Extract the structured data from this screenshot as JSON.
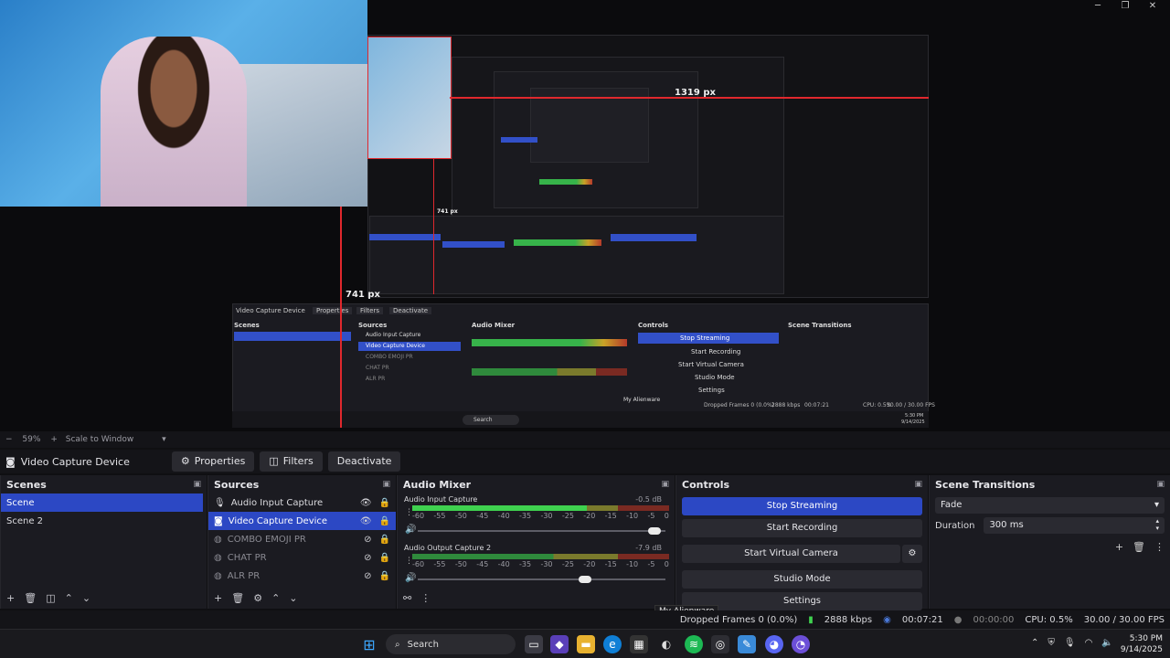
{
  "window": {
    "minimize": "─",
    "restore": "❐",
    "close": "✕"
  },
  "preview": {
    "label_width": "1319 px",
    "label_height_inner": "741 px",
    "label_height": "741 px",
    "nested_scene_title": "Video Capture Device",
    "nested_search": "Search",
    "nested_tooltip": "My Alienware",
    "nested_dropped": "Dropped Frames 0 (0.0%)",
    "nested_kbps": "2888 kbps",
    "nested_time": "00:07:21",
    "nested_cpu": "CPU: 0.5%",
    "nested_fps": "30.00 / 30.00 FPS",
    "nested_clock": "5:30 PM",
    "nested_date": "9/14/2025",
    "nested_items": [
      "Audio Input Capture",
      "Video Capture Device",
      "COMBO EMOJI PR",
      "CHAT PR",
      "ALR PR"
    ],
    "nested_buttons": [
      "Stop Streaming",
      "Start Recording",
      "Start Virtual Camera",
      "Studio Mode",
      "Settings"
    ],
    "nested_docks": [
      "Scenes",
      "Sources",
      "Audio Mixer",
      "Controls",
      "Scene Transitions"
    ],
    "nested_tabs": [
      "Properties",
      "Filters",
      "Deactivate"
    ]
  },
  "status1": {
    "zoom": "59%",
    "mode": "Scale to Window"
  },
  "context": {
    "title": "Video Capture Device",
    "properties": "Properties",
    "filters": "Filters",
    "deactivate": "Deactivate"
  },
  "scenes": {
    "title": "Scenes",
    "items": [
      "Scene",
      "Scene 2"
    ]
  },
  "sources": {
    "title": "Sources",
    "items": [
      "Audio Input Capture",
      "Video Capture Device",
      "COMBO EMOJI PR",
      "CHAT PR",
      "ALR PR"
    ]
  },
  "mixer": {
    "title": "Audio Mixer",
    "channels": [
      {
        "name": "Audio Input Capture",
        "db": "-0.5 dB",
        "level": 0.68,
        "volume": 0.98
      },
      {
        "name": "Audio Output Capture 2",
        "db": "-7.9 dB",
        "level": 0.0,
        "volume": 0.7
      }
    ],
    "scale": [
      "-60",
      "-55",
      "-50",
      "-45",
      "-40",
      "-35",
      "-30",
      "-25",
      "-20",
      "-15",
      "-10",
      "-5",
      "0"
    ]
  },
  "controls": {
    "title": "Controls",
    "stop_streaming": "Stop Streaming",
    "start_recording": "Start Recording",
    "start_virtual_camera": "Start Virtual Camera",
    "studio_mode": "Studio Mode",
    "settings": "Settings"
  },
  "transitions": {
    "title": "Scene Transitions",
    "selected": "Fade",
    "duration_label": "Duration",
    "duration_value": "300 ms"
  },
  "tooltip": "My Alienware",
  "statusbar": {
    "dropped": "Dropped Frames 0 (0.0%)",
    "kbps": "2888 kbps",
    "stream_time": "00:07:21",
    "rec_time": "00:00:00",
    "cpu": "CPU: 0.5%",
    "fps": "30.00 / 30.00 FPS"
  },
  "taskbar": {
    "search": "Search",
    "time": "5:30 PM",
    "date": "9/14/2025"
  },
  "colors": {
    "accent": "#2c48c4",
    "guide": "#e0282d",
    "meter_green": "#3fd14f"
  }
}
